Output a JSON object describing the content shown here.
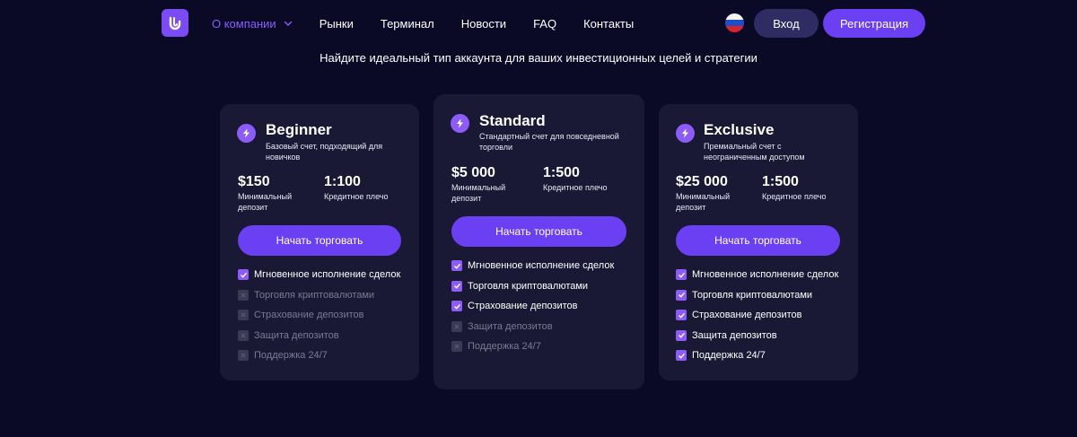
{
  "header": {
    "nav": [
      {
        "label": "О компании",
        "active": true,
        "dropdown": true
      },
      {
        "label": "Рынки"
      },
      {
        "label": "Терминал"
      },
      {
        "label": "Новости"
      },
      {
        "label": "FAQ"
      },
      {
        "label": "Контакты"
      }
    ],
    "language_flag": "russia-flag-icon",
    "login_label": "Вход",
    "register_label": "Регистрация"
  },
  "subtitle": "Найдите идеальный тип аккаунта для ваших инвестиционных целей и стратегии",
  "colors": {
    "background": "#0b0a26",
    "card": "#191935",
    "accent": "#6b3ff2",
    "active_nav": "#8a5cff"
  },
  "plans": [
    {
      "name": "Beginner",
      "description": "Базовый счет, подходящий для новичков",
      "deposit_value": "$150",
      "deposit_label": "Минимальный депозит",
      "leverage_value": "1:100",
      "leverage_label": "Кредитное плечо",
      "button_label": "Начать торговать",
      "features": [
        {
          "label": "Мгновенное исполнение сделок",
          "included": true
        },
        {
          "label": "Торговля криптовалютами",
          "included": false
        },
        {
          "label": "Страхование депозитов",
          "included": false
        },
        {
          "label": "Защита депозитов",
          "included": false
        },
        {
          "label": "Поддержка 24/7",
          "included": false
        }
      ]
    },
    {
      "name": "Standard",
      "description": "Стандартный счет для повседневной торговли",
      "deposit_value": "$5 000",
      "deposit_label": "Минимальный депозит",
      "leverage_value": "1:500",
      "leverage_label": "Кредитное плечо",
      "button_label": "Начать торговать",
      "features": [
        {
          "label": "Мгновенное исполнение сделок",
          "included": true
        },
        {
          "label": "Торговля криптовалютами",
          "included": true
        },
        {
          "label": "Страхование депозитов",
          "included": true
        },
        {
          "label": "Защита депозитов",
          "included": false
        },
        {
          "label": "Поддержка 24/7",
          "included": false
        }
      ]
    },
    {
      "name": "Exclusive",
      "description": "Премиальный счет с неограниченным доступом",
      "deposit_value": "$25 000",
      "deposit_label": "Минимальный депозит",
      "leverage_value": "1:500",
      "leverage_label": "Кредитное плечо",
      "button_label": "Начать торговать",
      "features": [
        {
          "label": "Мгновенное исполнение сделок",
          "included": true
        },
        {
          "label": "Торговля криптовалютами",
          "included": true
        },
        {
          "label": "Страхование депозитов",
          "included": true
        },
        {
          "label": "Защита депозитов",
          "included": true
        },
        {
          "label": "Поддержка 24/7",
          "included": true
        }
      ]
    }
  ]
}
